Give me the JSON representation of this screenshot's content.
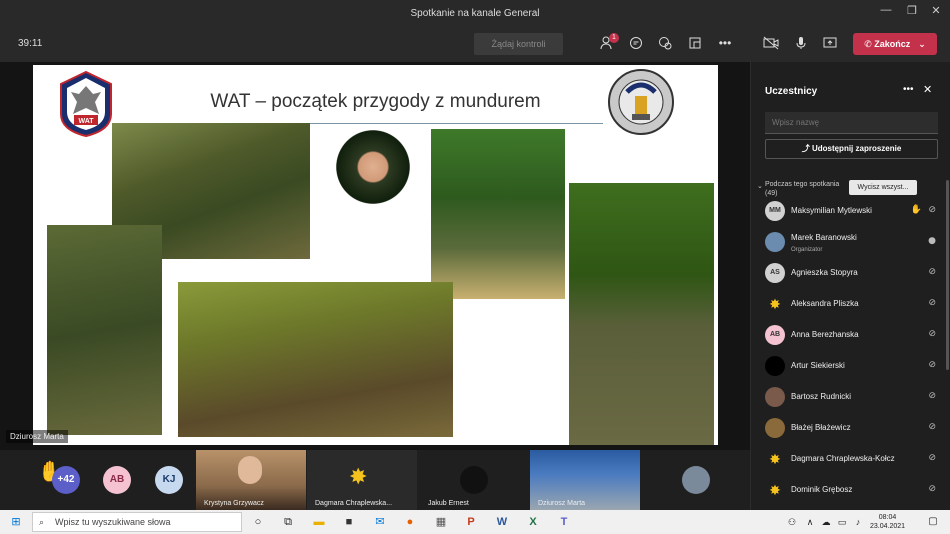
{
  "window": {
    "title": "Spotkanie na kanale General"
  },
  "toolbar": {
    "timer": "39:11",
    "request_control": "Żądaj kontroli",
    "participants_badge": "1",
    "leave_label": "Zakończ"
  },
  "slide": {
    "title": "WAT – początek przygody z mundurem",
    "logo_left_text": "WAT"
  },
  "stage": {
    "presenter": "Dziurosz Marta"
  },
  "strip": {
    "raised_count": "+42",
    "avatars": [
      "AB",
      "KJ"
    ],
    "tiles": [
      {
        "name": "Krystyna Grzywacz"
      },
      {
        "name": "Dagmara Chraplewska..."
      },
      {
        "name": "Jakub Ernest"
      },
      {
        "name": "Dziurosz Marta"
      }
    ]
  },
  "panel": {
    "title": "Uczestnicy",
    "search_placeholder": "Wpisz nazwę",
    "share_label": "Udostępnij zaproszenie",
    "during_label": "Podczas tego spotkania",
    "during_count": "(49)",
    "lower_all": "Wycisz wszyst...",
    "participants": [
      {
        "initials": "MM",
        "name": "Maksymilian Mytlewski",
        "color": "#d1d1d1",
        "hand": true
      },
      {
        "initials": "",
        "name": "Marek Baranowski",
        "sub": "Organizator",
        "color": "#6b8cae",
        "hand": false
      },
      {
        "initials": "AS",
        "name": "Agnieszka Stopyra",
        "color": "#d1d1d1",
        "hand": false
      },
      {
        "initials": "✸",
        "name": "Aleksandra Pliszka",
        "color": "#1f1f1f",
        "hand": false
      },
      {
        "initials": "AB",
        "name": "Anna Berezhanska",
        "color": "#f4c2d0",
        "hand": false
      },
      {
        "initials": "",
        "name": "Artur Siekierski",
        "color": "#000000",
        "hand": false
      },
      {
        "initials": "",
        "name": "Bartosz Rudnicki",
        "color": "#7a5a4a",
        "hand": false
      },
      {
        "initials": "",
        "name": "Błażej Błażewicz",
        "color": "#8a6a3a",
        "hand": false
      },
      {
        "initials": "✸",
        "name": "Dagmara Chraplewska-Kołcz",
        "color": "#1f1f1f",
        "hand": false
      },
      {
        "initials": "✸",
        "name": "Dominik Grębosz",
        "color": "#1f1f1f",
        "hand": false
      }
    ]
  },
  "taskbar": {
    "search_placeholder": "Wpisz tu wyszukiwane słowa",
    "time": "08:04",
    "date": "23.04.2021"
  }
}
